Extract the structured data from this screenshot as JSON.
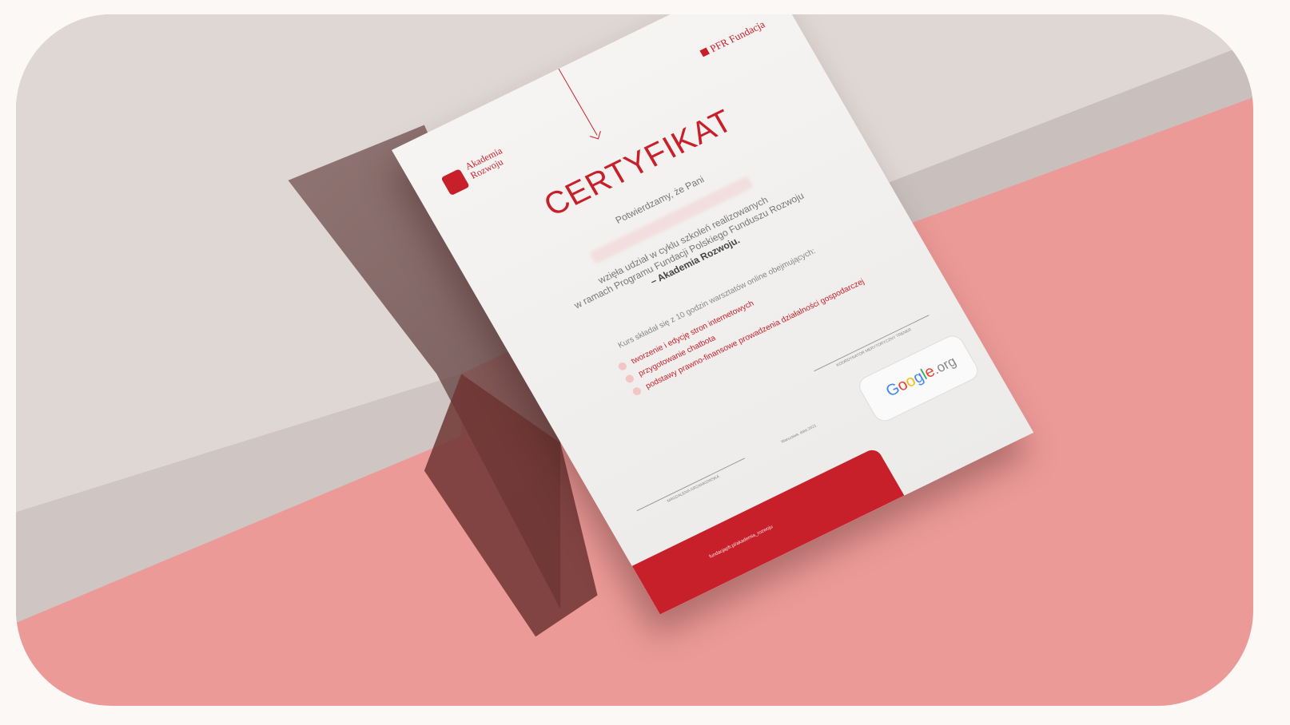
{
  "certificate": {
    "logo_text": "Akademia\nRozwoju",
    "partner": "PFR Fundacja",
    "title": "CERTYFIKAT",
    "confirm": "Potwierdzamy, że Pani",
    "para_1": "wzięła udział w cyklu szkoleń realizowanych",
    "para_2": "w ramach Programu Fundacji Polskiego Funduszu Rozwoju",
    "para_3": "– Akademia Rozwoju.",
    "course_intro": "Kurs składał się z 10 godzin warsztatów online obejmujących:",
    "topics": [
      "tworzenie i edycję stron internetowych",
      "przygotowanie chatbota",
      "podstawy prawno-finansowe prowadzenia działalności gospodarczej"
    ],
    "coordinator": "KOORDYNATOR MERYTORYCZNY TRENER",
    "signatory": "MAGDALENA GRZANKOWSKA",
    "date": "Warszawa, data 2021",
    "google_g1": "G",
    "google_o1": "o",
    "google_o2": "o",
    "google_g2": "g",
    "google_l": "l",
    "google_e": "e",
    "google_org": ".org",
    "footer_url": "fundacjapfr.pl/akademia_rozwoju"
  },
  "colors": {
    "accent": "#c8202a",
    "background_pink": "#ec9a97",
    "block_beige": "#dfd7d4",
    "page_bg": "#fbf8f6"
  }
}
